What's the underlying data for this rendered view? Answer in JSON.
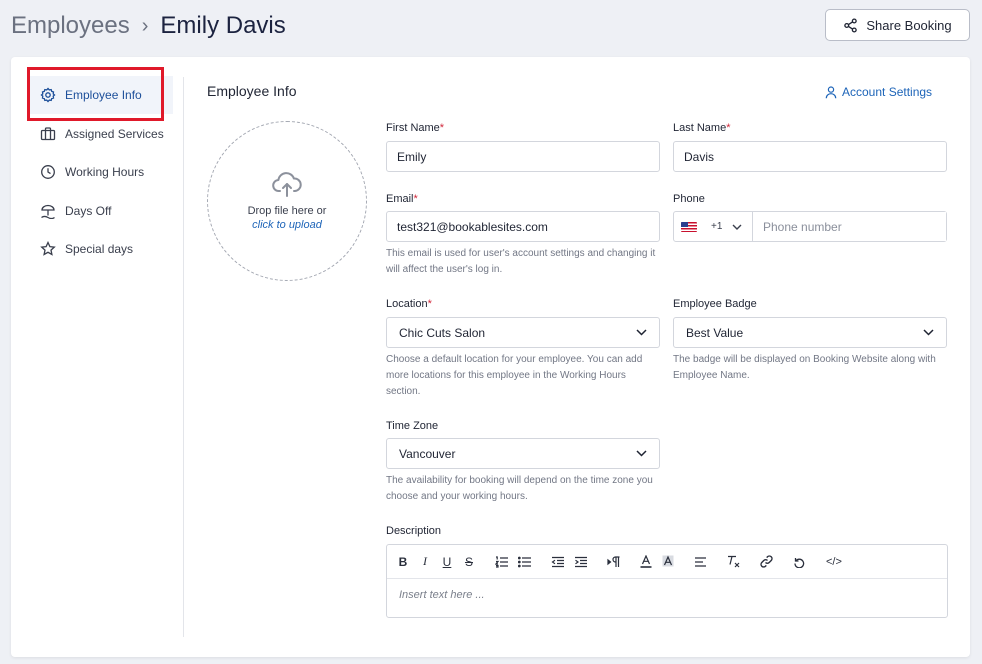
{
  "breadcrumb": {
    "parent": "Employees",
    "separator": "›",
    "current": "Emily Davis"
  },
  "header": {
    "share_label": "Share Booking"
  },
  "sidebar": {
    "items": [
      {
        "label": "Employee Info",
        "icon": "gear-icon",
        "active": true
      },
      {
        "label": "Assigned Services",
        "icon": "briefcase-icon"
      },
      {
        "label": "Working Hours",
        "icon": "clock-icon"
      },
      {
        "label": "Days Off",
        "icon": "beach-umbrella-icon"
      },
      {
        "label": "Special days",
        "icon": "star-icon"
      }
    ]
  },
  "main": {
    "title": "Employee Info",
    "account_settings": "Account Settings",
    "upload": {
      "text": "Drop file here or",
      "link": "click to upload"
    },
    "first_name": {
      "label": "First Name",
      "required": "*",
      "value": "Emily"
    },
    "last_name": {
      "label": "Last Name",
      "required": "*",
      "value": "Davis"
    },
    "email": {
      "label": "Email",
      "required": "*",
      "value": "test321@bookablesites.com",
      "help": "This email is used for user's account settings and changing it will affect the user's log in."
    },
    "phone": {
      "label": "Phone",
      "country_code": "+1",
      "placeholder": "Phone number"
    },
    "location": {
      "label": "Location",
      "required": "*",
      "value": "Chic Cuts Salon",
      "help": "Choose a default location for your employee. You can add more locations for this employee in the Working Hours section."
    },
    "badge": {
      "label": "Employee Badge",
      "value": "Best Value",
      "help": "The badge will be displayed on Booking Website along with Employee Name."
    },
    "timezone": {
      "label": "Time Zone",
      "value": "Vancouver",
      "help": "The availability for booking will depend on the time zone you choose and your working hours."
    },
    "description": {
      "label": "Description",
      "placeholder": "Insert text here ..."
    }
  },
  "colors": {
    "accent": "#1d64b8",
    "highlight": "#e0192a",
    "required": "#d1283a"
  }
}
